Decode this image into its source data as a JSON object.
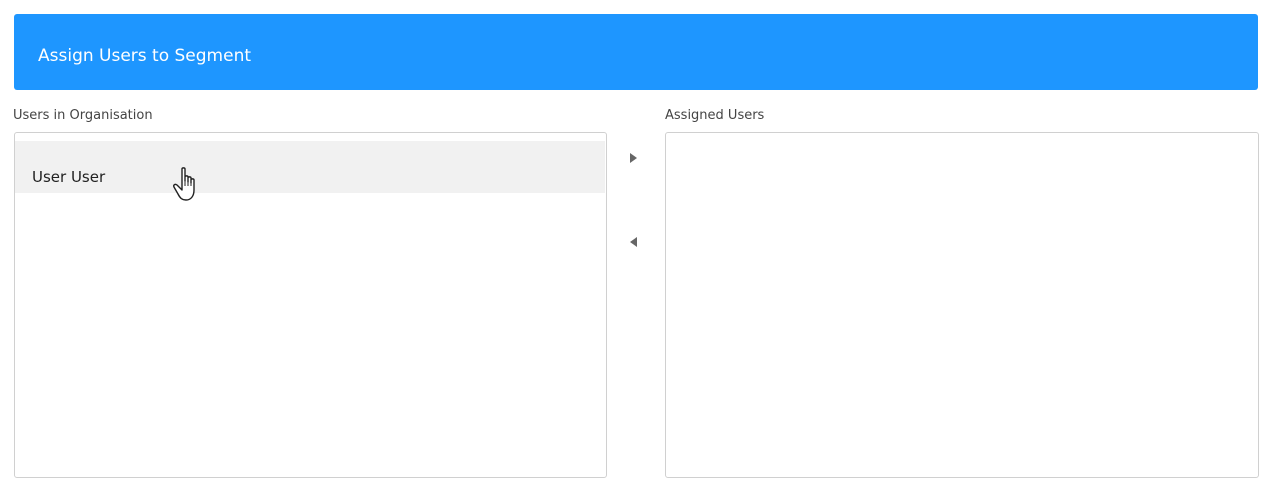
{
  "header": {
    "title": "Assign Users to Segment",
    "color": "#1e96ff"
  },
  "left_panel": {
    "label": "Users in Organisation",
    "items": [
      {
        "label": "User User"
      }
    ]
  },
  "right_panel": {
    "label": "Assigned Users",
    "items": []
  },
  "controls": {
    "move_right_icon": "triangle-right-icon",
    "move_left_icon": "triangle-left-icon"
  },
  "cursor_icon": "hand-pointer-icon"
}
